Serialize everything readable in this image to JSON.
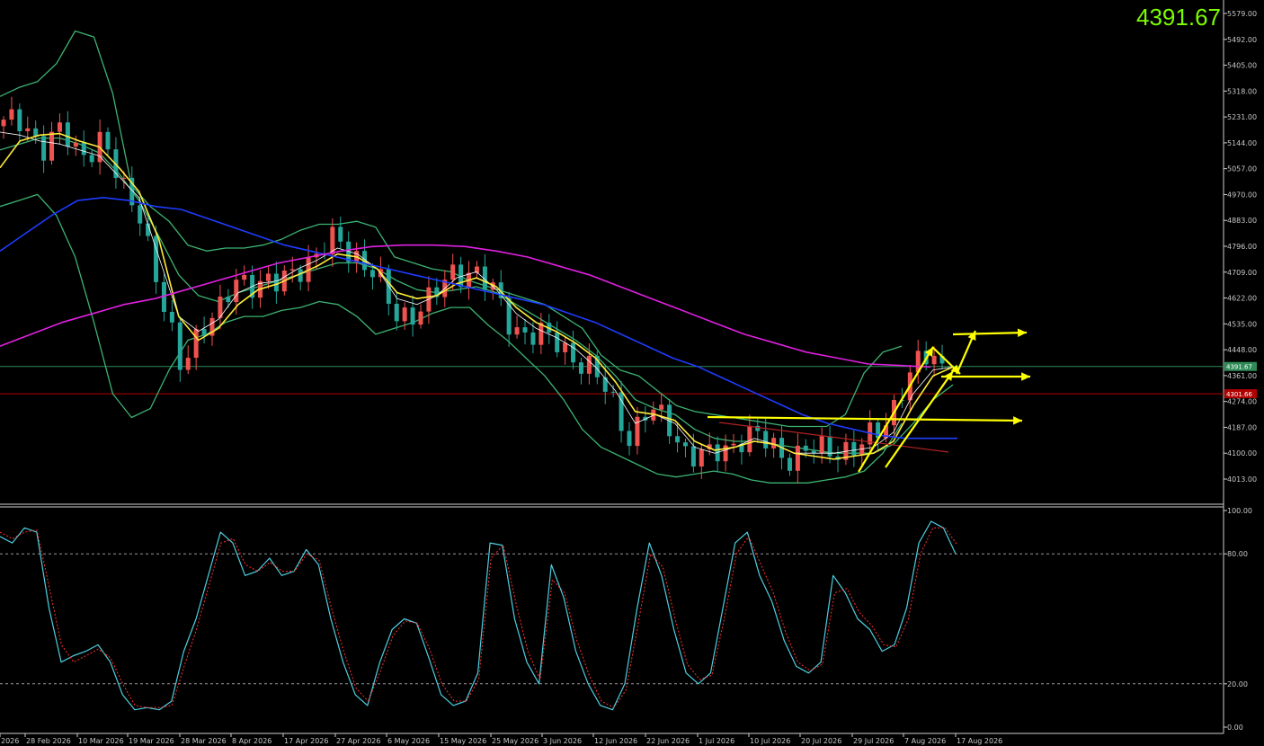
{
  "price_display": "4391.67",
  "colors": {
    "background": "#000000",
    "bull_candle": "#ef5350",
    "bear_candle": "#26a69a",
    "ma_fast": "#ffffff",
    "ma_yellow": "#ffeb3b",
    "bollinger": "#3cb371",
    "ma_blue": "#1e3cff",
    "ma_magenta": "#e020e0",
    "stoch_main": "#4dd0e1",
    "stoch_signal": "#ff3030",
    "annotation": "#ffff00",
    "current_price_line": "#2e8b57",
    "red_level_line": "#b00000",
    "price_display": "#7CFC00"
  },
  "chart_data": [
    {
      "type": "candlestick",
      "panel": "price",
      "ylim": [
        3970,
        5600
      ],
      "y_ticks": [
        "5579.00",
        "5492.00",
        "5405.00",
        "5318.00",
        "5231.00",
        "5144.00",
        "5057.00",
        "4970.00",
        "4883.00",
        "4796.00",
        "4709.00",
        "4622.00",
        "4535.00",
        "4448.00",
        "4361.00",
        "4274.00",
        "4187.00",
        "4100.00",
        "4013.00"
      ],
      "x_labels": [
        "2026",
        "28 Feb 2026",
        "10 Mar 2026",
        "19 Mar 2026",
        "28 Mar 2026",
        "8 Apr 2026",
        "17 Apr 2026",
        "27 Apr 2026",
        "6 May 2026",
        "15 May 2026",
        "25 May 2026",
        "3 Jun 2026",
        "12 Jun 2026",
        "22 Jun 2026",
        "1 Jul 2026",
        "10 Jul 2026",
        "20 Jul 2026",
        "29 Jul 2026",
        "7 Aug 2026",
        "17 Aug 2026"
      ],
      "current_price": 4391.67,
      "current_price_label": "4391.67",
      "red_level": 4300,
      "red_level_label": "4301.66",
      "close_path": [
        5200,
        5230,
        5120,
        5180,
        5110,
        5150,
        5000,
        4920,
        4620,
        4400,
        4520,
        4560,
        4700,
        4670,
        4660,
        4730,
        4760,
        4820,
        4770,
        4700,
        4560,
        4580,
        4620,
        4710,
        4720,
        4640,
        4530,
        4500,
        4480,
        4440,
        4380,
        4290,
        4160,
        4240,
        4200,
        4100,
        4080,
        4120,
        4170,
        4130,
        4090,
        4110,
        4100,
        4120,
        4130,
        4180,
        4340,
        4420,
        4390
      ],
      "series": [
        {
          "name": "",
          "role": "ma_fast",
          "values": [
            5180,
            5170,
            5150,
            5140,
            5120,
            5100,
            5030,
            4960,
            4760,
            4560,
            4510,
            4550,
            4640,
            4670,
            4680,
            4720,
            4750,
            4790,
            4770,
            4720,
            4620,
            4600,
            4630,
            4690,
            4710,
            4650,
            4570,
            4520,
            4490,
            4450,
            4390,
            4310,
            4200,
            4230,
            4200,
            4120,
            4100,
            4120,
            4150,
            4130,
            4100,
            4100,
            4100,
            4110,
            4120,
            4170,
            4300,
            4380,
            4390
          ]
        },
        {
          "name": "",
          "role": "ma_yellow",
          "values": [
            5060,
            5150,
            5170,
            5175,
            5150,
            5130,
            5060,
            4980,
            4820,
            4560,
            4480,
            4520,
            4600,
            4650,
            4670,
            4700,
            4730,
            4770,
            4760,
            4720,
            4640,
            4620,
            4630,
            4670,
            4690,
            4660,
            4590,
            4540,
            4510,
            4470,
            4420,
            4340,
            4240,
            4230,
            4210,
            4140,
            4110,
            4120,
            4140,
            4130,
            4100,
            4090,
            4080,
            4090,
            4100,
            4140,
            4260,
            4360,
            4390
          ]
        },
        {
          "name": "",
          "role": "boll_mid",
          "values": [
            5120,
            5140,
            5160,
            5160,
            5140,
            5110,
            5040,
            4950,
            4830,
            4700,
            4630,
            4610,
            4640,
            4660,
            4680,
            4700,
            4720,
            4740,
            4740,
            4720,
            4680,
            4650,
            4640,
            4650,
            4660,
            4640,
            4600,
            4560,
            4520,
            4480,
            4430,
            4360,
            4280,
            4250,
            4230,
            4180,
            4150,
            4140,
            4140,
            4130,
            4120,
            4110,
            4100,
            4100,
            4100,
            4130,
            4200,
            4280,
            4330
          ]
        },
        {
          "name": "",
          "role": "boll_upper",
          "values": [
            5300,
            5330,
            5350,
            5410,
            5520,
            5500,
            5310,
            5000,
            4930,
            4880,
            4800,
            4780,
            4790,
            4790,
            4800,
            4820,
            4850,
            4870,
            4870,
            4880,
            4860,
            4760,
            4740,
            4720,
            4710,
            4680,
            4660,
            4640,
            4620,
            4600,
            4560,
            4520,
            4430,
            4380,
            4360,
            4310,
            4260,
            4240,
            4230,
            4220,
            4210,
            4200,
            4190,
            4190,
            4190,
            4230,
            4370,
            4440,
            4460
          ]
        },
        {
          "name": "",
          "role": "boll_lower",
          "values": [
            4930,
            4950,
            4970,
            4900,
            4760,
            4540,
            4300,
            4220,
            4250,
            4380,
            4480,
            4500,
            4540,
            4560,
            4560,
            4580,
            4590,
            4610,
            4600,
            4560,
            4500,
            4520,
            4540,
            4570,
            4590,
            4590,
            4530,
            4480,
            4420,
            4360,
            4280,
            4180,
            4120,
            4090,
            4060,
            4030,
            4020,
            4030,
            4040,
            4030,
            4010,
            4000,
            4000,
            4000,
            4010,
            4020,
            4040,
            4100,
            4200
          ]
        },
        {
          "name": "",
          "role": "ma_blue",
          "values": [
            4780,
            4840,
            4900,
            4950,
            4960,
            4950,
            4930,
            4920,
            4890,
            4860,
            4830,
            4800,
            4780,
            4760,
            4740,
            4720,
            4700,
            4680,
            4660,
            4640,
            4620,
            4600,
            4570,
            4540,
            4500,
            4460,
            4420,
            4390,
            4350,
            4310,
            4270,
            4230,
            4200,
            4180,
            4160,
            4150,
            4150,
            4150
          ]
        },
        {
          "name": "",
          "role": "ma_magenta",
          "values": [
            4460,
            4500,
            4540,
            4570,
            4600,
            4620,
            4650,
            4680,
            4710,
            4740,
            4760,
            4780,
            4795,
            4800,
            4800,
            4795,
            4780,
            4760,
            4730,
            4700,
            4660,
            4620,
            4580,
            4540,
            4500,
            4470,
            4440,
            4420,
            4400,
            4395,
            4390
          ]
        }
      ]
    },
    {
      "type": "line",
      "panel": "stochastic",
      "ylim": [
        0,
        100
      ],
      "y_ticks": [
        "100.00",
        "80.00",
        "20.00",
        "0.00"
      ],
      "levels": [
        80,
        20
      ],
      "series": [
        {
          "name": "",
          "role": "main",
          "values": [
            88,
            85,
            92,
            90,
            55,
            30,
            33,
            35,
            38,
            30,
            15,
            8,
            9,
            8,
            12,
            35,
            50,
            70,
            90,
            85,
            70,
            72,
            78,
            70,
            72,
            82,
            75,
            50,
            30,
            15,
            10,
            30,
            45,
            50,
            48,
            32,
            15,
            10,
            12,
            25,
            85,
            84,
            50,
            30,
            20,
            75,
            60,
            35,
            20,
            10,
            8,
            20,
            55,
            85,
            70,
            45,
            25,
            20,
            25,
            55,
            85,
            90,
            70,
            58,
            40,
            28,
            25,
            30,
            70,
            62,
            50,
            45,
            35,
            38,
            55,
            85,
            95,
            92,
            80
          ]
        },
        {
          "name": "",
          "role": "signal",
          "values": [
            90,
            87,
            90,
            91,
            65,
            38,
            30,
            33,
            36,
            32,
            20,
            10,
            9,
            9,
            10,
            28,
            45,
            65,
            85,
            87,
            75,
            72,
            76,
            72,
            72,
            80,
            77,
            55,
            35,
            18,
            12,
            26,
            42,
            49,
            48,
            36,
            20,
            12,
            12,
            22,
            78,
            84,
            58,
            35,
            22,
            68,
            62,
            40,
            24,
            12,
            9,
            17,
            48,
            80,
            74,
            50,
            29,
            22,
            24,
            50,
            80,
            88,
            75,
            62,
            44,
            30,
            26,
            29,
            62,
            64,
            53,
            47,
            38,
            37,
            50,
            80,
            92,
            92,
            84
          ]
        }
      ]
    }
  ]
}
